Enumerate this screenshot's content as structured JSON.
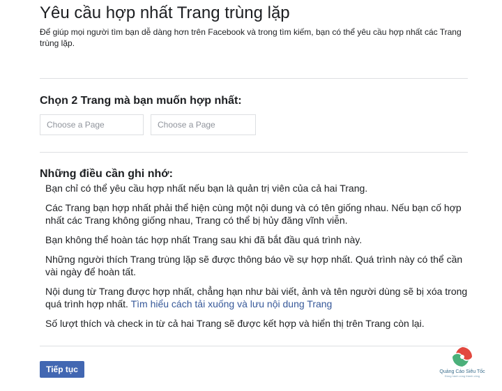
{
  "page": {
    "title": "Yêu cầu hợp nhất Trang trùng lặp",
    "intro": "Để giúp mọi người tìm bạn dễ dàng hơn trên Facebook và trong tìm kiếm, bạn có thể yêu cầu hợp nhất các Trang trùng lặp."
  },
  "select": {
    "title": "Chọn 2 Trang mà bạn muốn hợp nhất:",
    "page1_placeholder": "Choose a Page",
    "page2_placeholder": "Choose a Page"
  },
  "notes": {
    "title": "Những điều cần ghi nhớ:",
    "items": [
      "Bạn chỉ có thể yêu cầu hợp nhất nếu bạn là quản trị viên của cả hai Trang.",
      "Các Trang bạn hợp nhất phải thể hiện cùng một nội dung và có tên giống nhau. Nếu bạn cố hợp nhất các Trang không giống nhau, Trang có thể bị hủy đăng vĩnh viễn.",
      "Bạn không thể hoàn tác hợp nhất Trang sau khi đã bắt đầu quá trình này.",
      "Những người thích Trang trùng lặp sẽ được thông báo về sự hợp nhất. Quá trình này có thể cần vài ngày để hoàn tất.",
      "Nội dung từ Trang được hợp nhất, chẳng hạn như bài viết, ảnh và tên người dùng sẽ bị xóa trong quá trình hợp nhất.",
      "Số lượt thích và check in từ cả hai Trang sẽ được kết hợp và hiển thị trên Trang còn lại."
    ],
    "link_text": "Tìm hiểu cách tải xuống và lưu nội dung Trang"
  },
  "actions": {
    "continue_label": "Tiếp tục"
  },
  "watermark": {
    "name": "Quảng Cáo Siêu Tốc",
    "tagline": "Đồng hành cùng thành công"
  },
  "colors": {
    "button": "#4267b2",
    "link": "#365899",
    "divider": "#dddfe2",
    "logo_red": "#e2483f",
    "logo_green": "#4bb07a"
  }
}
